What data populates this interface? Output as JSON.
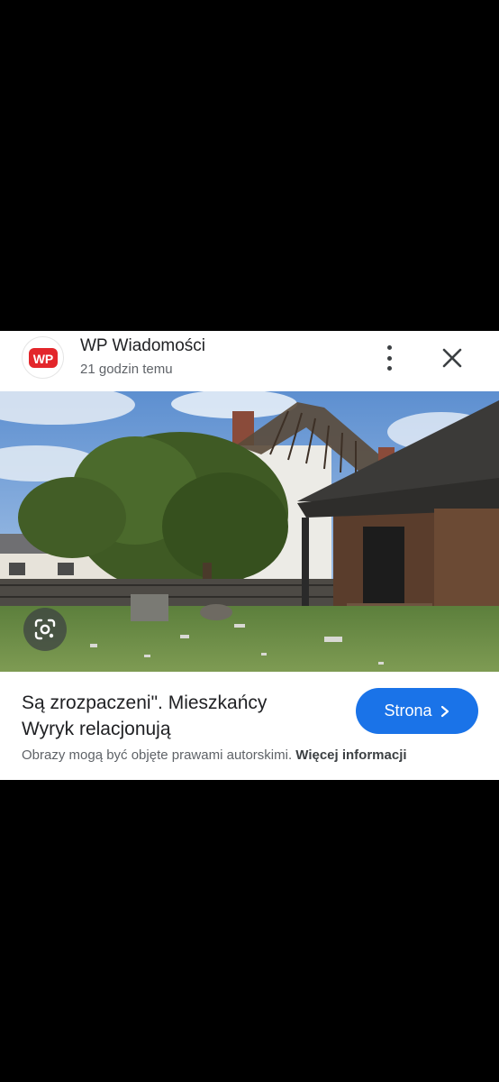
{
  "source": {
    "name": "WP Wiadomości",
    "timestamp": "21 godzin temu",
    "logo_text": "WP",
    "brand_color": "#e3262b"
  },
  "header_actions": {
    "more_icon": "more-vert-icon",
    "close_icon": "close-icon"
  },
  "image": {
    "lens_icon": "google-lens-icon"
  },
  "article": {
    "title_line1": "Są zrozpaczeni\". Mieszkańcy",
    "title_line2": "Wyryk relacjonują"
  },
  "visit_button": {
    "label": "Strona",
    "icon": "chevron-right-icon",
    "color": "#1a73e8"
  },
  "footer": {
    "copyright_text": "Obrazy mogą być objęte prawami autorskimi.",
    "more_info_link": "Więcej informacji"
  }
}
